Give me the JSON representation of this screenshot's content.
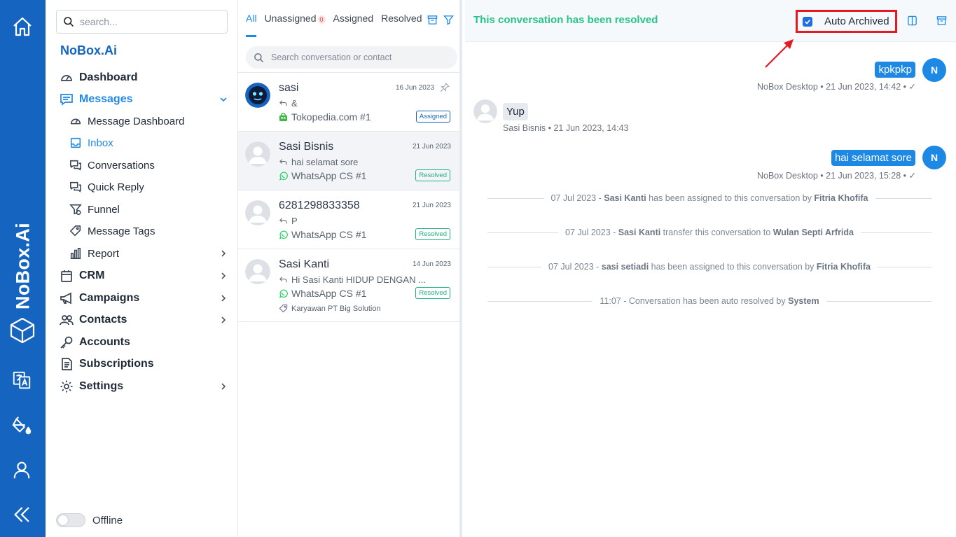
{
  "rail": {
    "brand": "NoBox.Ai",
    "icons": [
      "home-icon",
      "translate-icon",
      "paint-bucket-icon",
      "user-icon",
      "collapse-icon"
    ]
  },
  "sidebar": {
    "search_placeholder": "search...",
    "brand": "NoBox.Ai",
    "items": {
      "dashboard": "Dashboard",
      "messages": "Messages",
      "message_dashboard": "Message Dashboard",
      "inbox": "Inbox",
      "conversations": "Conversations",
      "quick_reply": "Quick Reply",
      "funnel": "Funnel",
      "message_tags": "Message Tags",
      "report": "Report",
      "crm": "CRM",
      "campaigns": "Campaigns",
      "contacts": "Contacts",
      "accounts": "Accounts",
      "subscriptions": "Subscriptions",
      "settings": "Settings"
    },
    "status_label": "Offline"
  },
  "convlist": {
    "tabs": {
      "all": "All",
      "unassigned": "Unassigned",
      "unassigned_count": "0",
      "assigned": "Assigned",
      "resolved": "Resolved"
    },
    "search_placeholder": "Search conversation or contact",
    "conversations": [
      {
        "name": "sasi",
        "date": "16 Jun 2023",
        "preview": "&",
        "channel": "Tokopedia.com #1",
        "status": "Assigned"
      },
      {
        "name": "Sasi Bisnis",
        "date": "21 Jun 2023",
        "preview": "hai selamat sore",
        "channel": "WhatsApp CS #1",
        "status": "Resolved"
      },
      {
        "name": "6281298833358",
        "date": "21 Jun 2023",
        "preview": "P",
        "channel": "WhatsApp CS #1",
        "status": "Resolved"
      },
      {
        "name": "Sasi Kanti",
        "date": "14 Jun 2023",
        "preview": "Hi Sasi Kanti HIDUP DENGAN ...",
        "channel": "WhatsApp CS #1",
        "status": "Resolved",
        "tag": "Karyawan PT Big Solution"
      }
    ]
  },
  "chat": {
    "header_title": "This conversation has been resolved",
    "auto_archived_label": "Auto Archived",
    "auto_archived_checked": true,
    "messages": [
      {
        "dir": "out",
        "text": "kpkpkp",
        "meta": "NoBox Desktop • 21 Jun 2023, 14:42 •",
        "avatar": "N"
      },
      {
        "dir": "in",
        "text": "Yup",
        "meta": "Sasi Bisnis • 21 Jun 2023, 14:43"
      },
      {
        "dir": "out",
        "text": "hai selamat sore",
        "meta": "NoBox Desktop • 21 Jun 2023, 15:28 •",
        "avatar": "N"
      }
    ],
    "system_events": [
      {
        "pre": "07 Jul 2023 - ",
        "b1": "Sasi Kanti",
        "mid": " has been assigned to this conversation by ",
        "b2": "Fitria Khofifa"
      },
      {
        "pre": "07 Jul 2023 - ",
        "b1": "Sasi Kanti",
        "mid": " transfer this conversation to ",
        "b2": "Wulan Septi Arfrida"
      },
      {
        "pre": "07 Jul 2023 - ",
        "b1": "sasi setiadi",
        "mid": " has been assigned to this conversation by ",
        "b2": "Fitria Khofifa"
      },
      {
        "pre": "11:07 - Conversation has been auto resolved by ",
        "b1": "",
        "mid": "",
        "b2": "System"
      }
    ]
  },
  "colors": {
    "primary": "#1565c0",
    "accent": "#1e88e5",
    "resolved": "#22b07d",
    "highlight": "#e41b23"
  }
}
